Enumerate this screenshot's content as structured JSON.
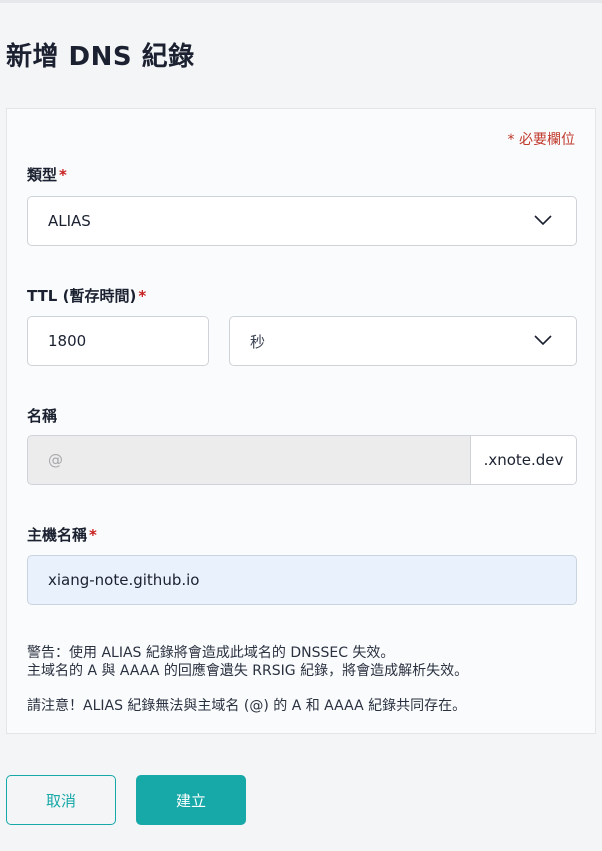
{
  "page": {
    "title": "新增 DNS 紀錄"
  },
  "form": {
    "required_note": "* 必要欄位",
    "required_star": "*",
    "type": {
      "label": "類型",
      "value": "ALIAS"
    },
    "ttl": {
      "label": "TTL (暫存時間)",
      "value": "1800",
      "unit": "秒"
    },
    "name": {
      "label": "名稱",
      "placeholder": "@",
      "suffix": ".xnote.dev"
    },
    "hostname": {
      "label": "主機名稱",
      "value": "xiang-note.github.io"
    },
    "warning": {
      "line1": "警告：使用 ALIAS 紀錄將會造成此域名的 DNSSEC 失效。",
      "line2": "主域名的 A 與 AAAA 的回應會遺失 RRSIG 紀錄，將會造成解析失效。",
      "line3": "請注意！ALIAS 紀錄無法與主域名 (@) 的 A 和 AAAA 紀錄共同存在。"
    }
  },
  "actions": {
    "cancel_label": "取消",
    "create_label": "建立"
  },
  "colors": {
    "accent": "#17a8a8",
    "required": "#c81e1e",
    "active_field_bg": "#e9f1fc"
  },
  "icons": {
    "dropdown": "chevron-down-icon"
  }
}
